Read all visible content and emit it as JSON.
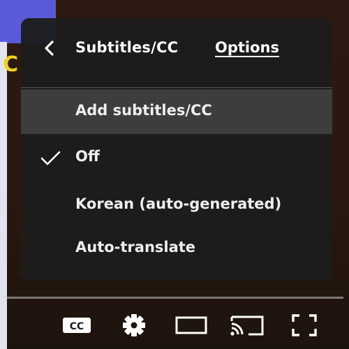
{
  "menu": {
    "title": "Subtitles/CC",
    "options_label": "Options",
    "items": [
      {
        "label": "Add subtitles/CC",
        "highlighted": true,
        "selected": false
      },
      {
        "label": "Off",
        "highlighted": false,
        "selected": true
      },
      {
        "label": "Korean (auto-generated)",
        "highlighted": false,
        "selected": false
      },
      {
        "label": "Auto-translate",
        "highlighted": false,
        "selected": false
      }
    ]
  },
  "background": {
    "visible_letter": "C"
  },
  "controls": {
    "subtitles_button_label": "CC",
    "icons": [
      "subtitles-cc-icon",
      "settings-gear-icon",
      "theater-mode-icon",
      "cast-icon",
      "fullscreen-icon"
    ]
  },
  "colors": {
    "menu_bg": "#1c1c1c",
    "highlight_bg": "#3d3d3d",
    "text": "#ffffff",
    "accent_letter": "#f0d21e",
    "bg_blue": "#5a5ad8"
  }
}
